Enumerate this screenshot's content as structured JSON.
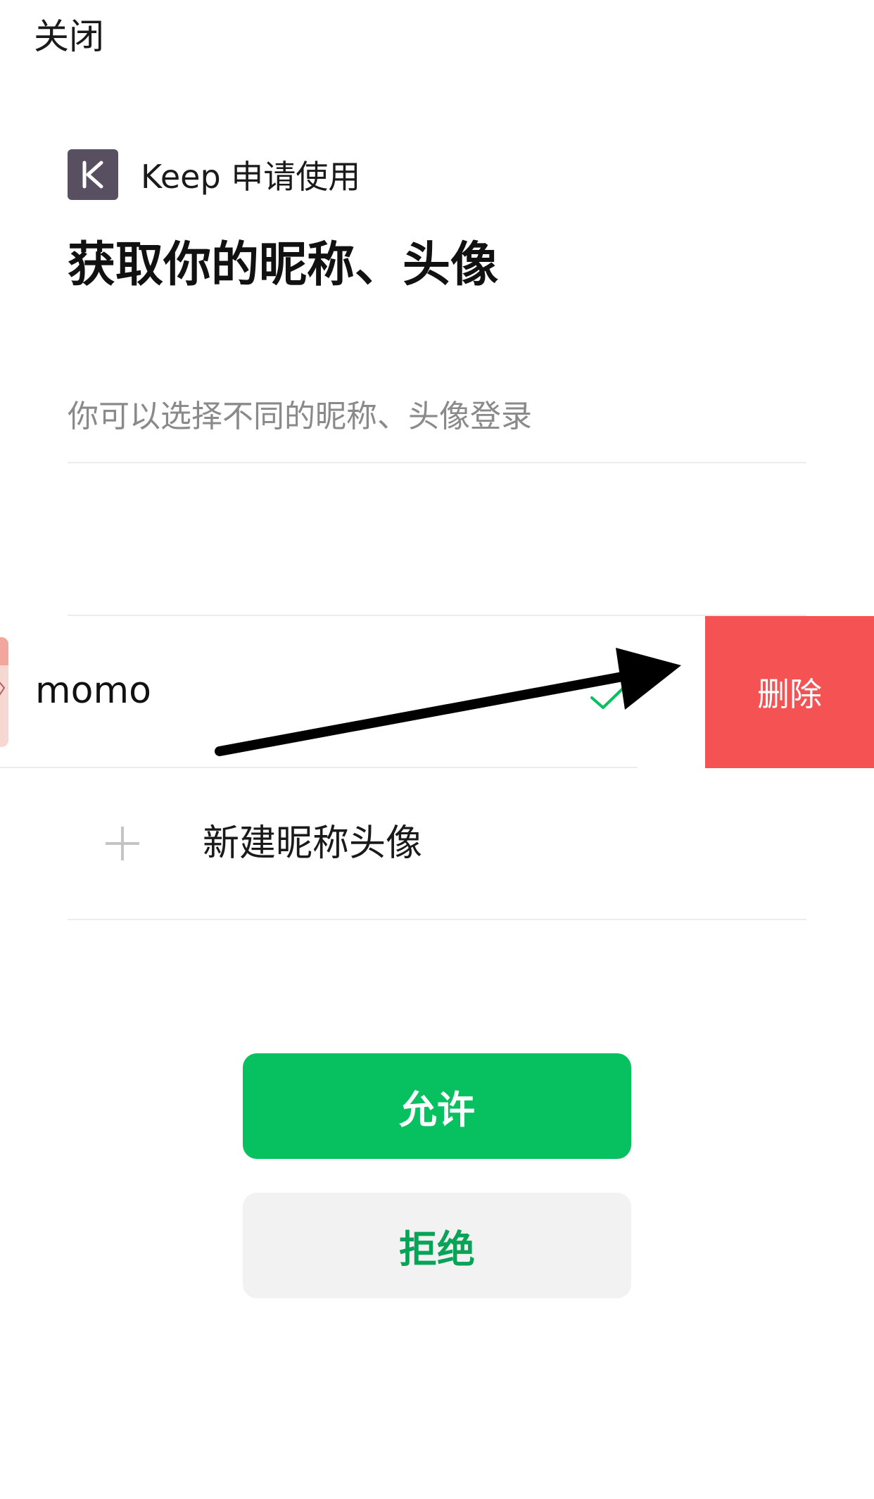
{
  "header": {
    "close_label": "关闭"
  },
  "app": {
    "logo_letter": "K",
    "request_text": "Keep 申请使用",
    "logo_color": "#584f60"
  },
  "title": "获取你的昵称、头像",
  "subtitle": "你可以选择不同的昵称、头像登录",
  "profile": {
    "name": "momo",
    "selected": true,
    "delete_label": "删除",
    "delete_color": "#f55353",
    "check_icon": "checkmark-icon"
  },
  "new_profile": {
    "label": "新建昵称头像",
    "icon": "plus-icon"
  },
  "actions": {
    "allow_label": "允许",
    "deny_label": "拒绝",
    "allow_color": "#07c160",
    "deny_text_color": "#07a356"
  }
}
